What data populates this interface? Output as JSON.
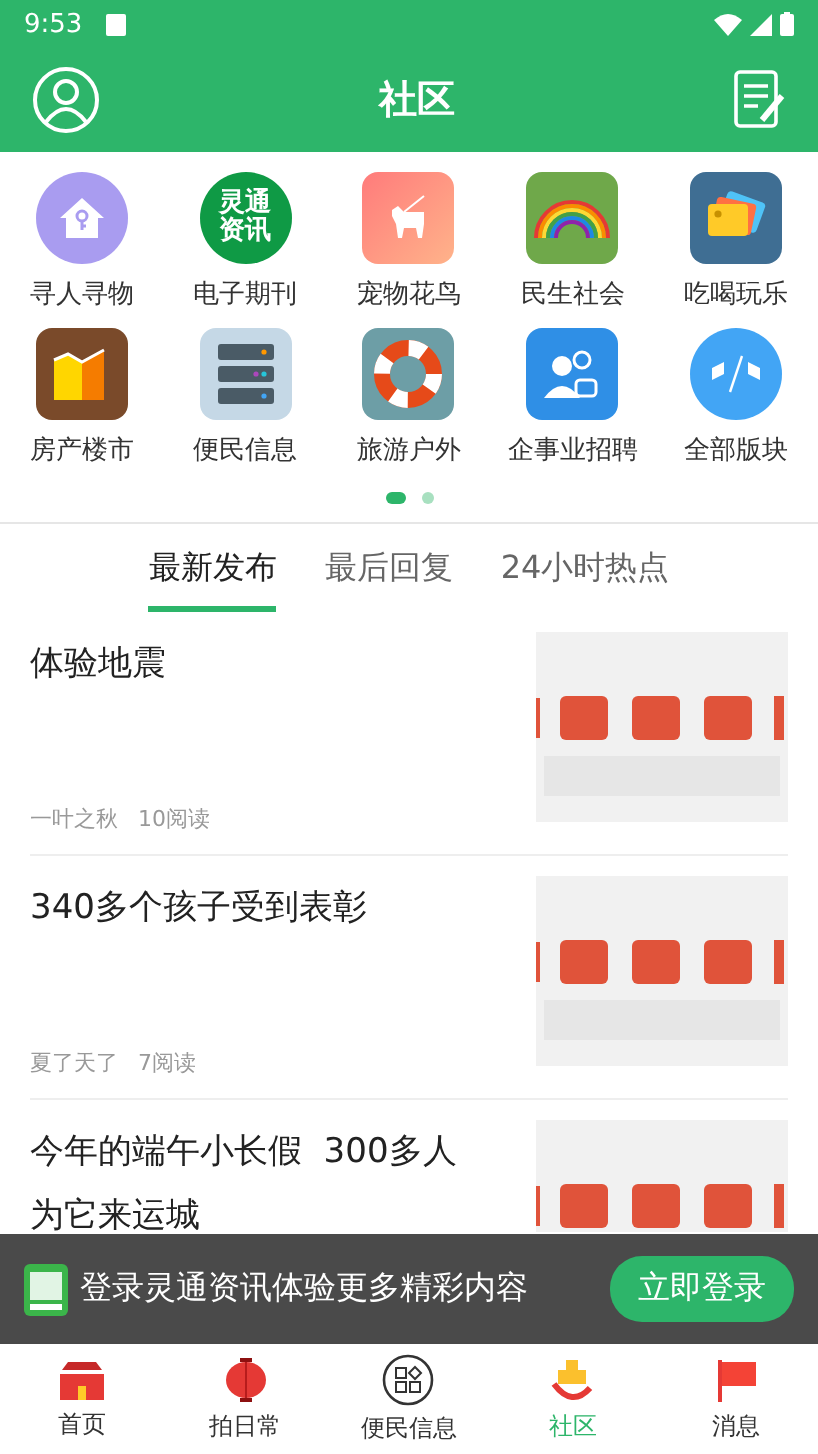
{
  "status_bar": {
    "time": "9:53"
  },
  "header": {
    "title": "社区"
  },
  "categories": [
    {
      "label": "寻人寻物",
      "kind": "house"
    },
    {
      "label": "电子期刊",
      "kind": "logo",
      "logo_text": "灵通资讯"
    },
    {
      "label": "宠物花鸟",
      "kind": "dog"
    },
    {
      "label": "民生社会",
      "kind": "rainbow"
    },
    {
      "label": "吃喝玩乐",
      "kind": "tags"
    },
    {
      "label": "房产楼市",
      "kind": "chart"
    },
    {
      "label": "便民信息",
      "kind": "server"
    },
    {
      "label": "旅游户外",
      "kind": "lifebuoy"
    },
    {
      "label": "企事业招聘",
      "kind": "people"
    },
    {
      "label": "全部版块",
      "kind": "flags"
    }
  ],
  "pager": [
    {
      "selected": true
    },
    {
      "selected": false
    }
  ],
  "tabs": [
    {
      "label": "最新发布",
      "selected": true
    },
    {
      "label": "最后回复",
      "selected": false
    },
    {
      "label": "24小时热点",
      "selected": false
    }
  ],
  "posts": [
    {
      "title": "体验地震",
      "author": "一叶之秋",
      "reads": "10阅读"
    },
    {
      "title": "340多个孩子受到表彰",
      "author": "夏了天了",
      "reads": "7阅读"
    },
    {
      "title": "今年的端午小长假  300多人为它来运城"
    }
  ],
  "login_banner": {
    "text": "登录灵通资讯体验更多精彩内容",
    "button": "立即登录"
  },
  "bottom_nav": [
    {
      "label": "首页",
      "kind": "gate",
      "selected": false
    },
    {
      "label": "拍日常",
      "kind": "lantern",
      "selected": false
    },
    {
      "label": "便民信息",
      "kind": "grid",
      "selected": false
    },
    {
      "label": "社区",
      "kind": "community",
      "selected": true
    },
    {
      "label": "消息",
      "kind": "flag",
      "selected": false
    }
  ]
}
